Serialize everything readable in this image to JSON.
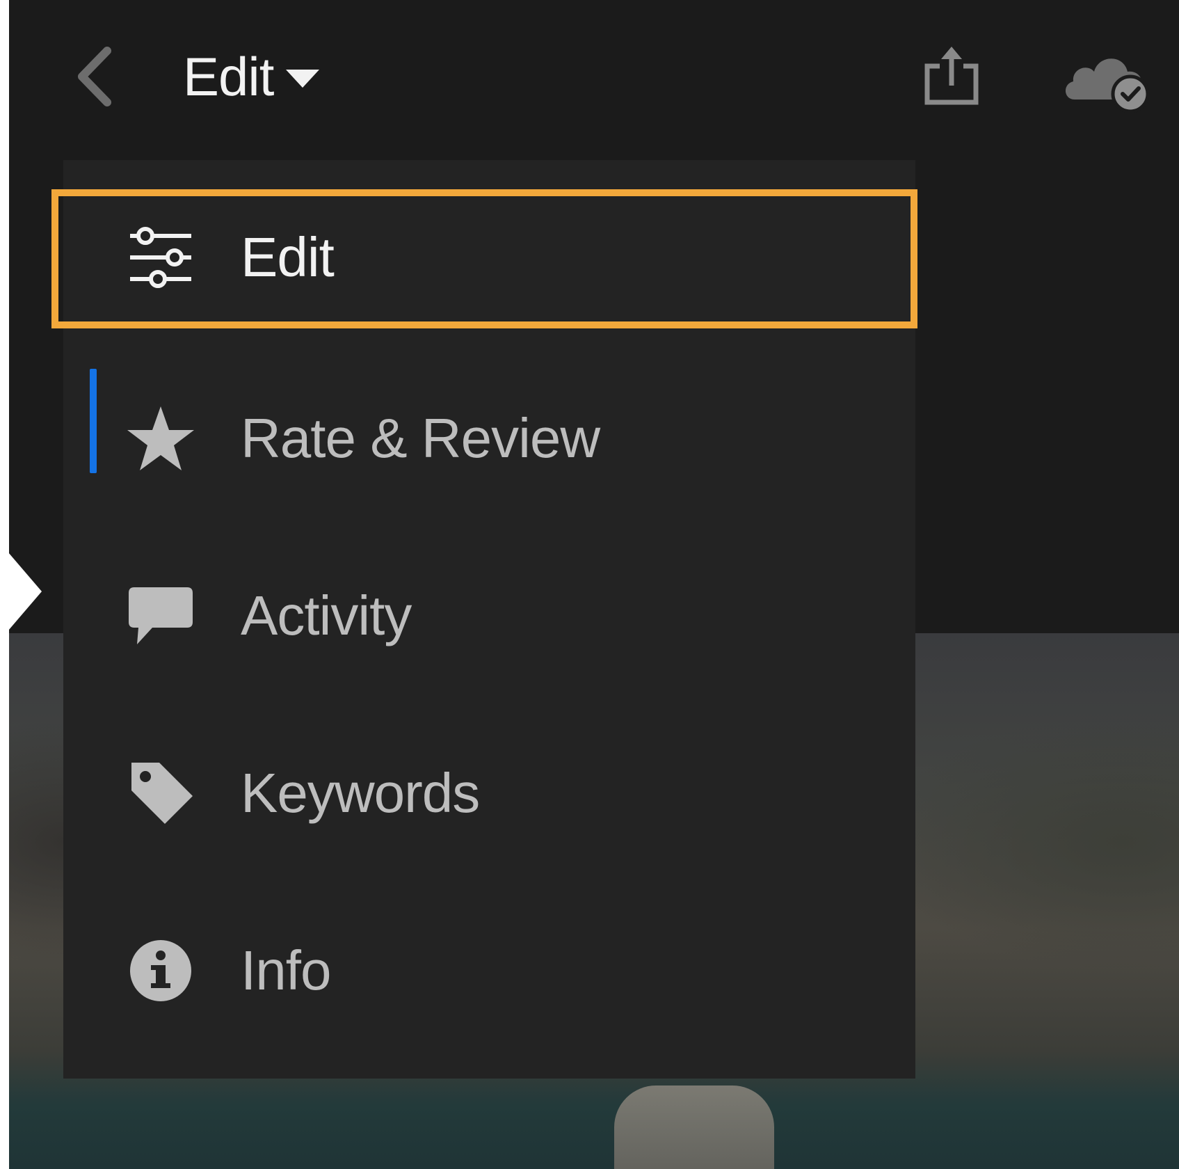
{
  "header": {
    "title": "Edit",
    "back_icon": "chevron-left-icon",
    "share_icon": "share-icon",
    "cloud_icon": "cloud-synced-icon"
  },
  "menu": {
    "items": [
      {
        "label": "Edit",
        "icon": "sliders-icon",
        "active": true
      },
      {
        "label": "Rate & Review",
        "icon": "star-icon",
        "active": false
      },
      {
        "label": "Activity",
        "icon": "comment-icon",
        "active": false
      },
      {
        "label": "Keywords",
        "icon": "tag-icon",
        "active": false
      },
      {
        "label": "Info",
        "icon": "info-icon",
        "active": false
      }
    ]
  },
  "colors": {
    "background": "#1b1b1b",
    "menu_background": "#232323",
    "active_indicator": "#1473e6",
    "highlight_border": "#f3a83b",
    "active_text": "#f2f2f2",
    "inactive_text": "#bdbdbd"
  }
}
